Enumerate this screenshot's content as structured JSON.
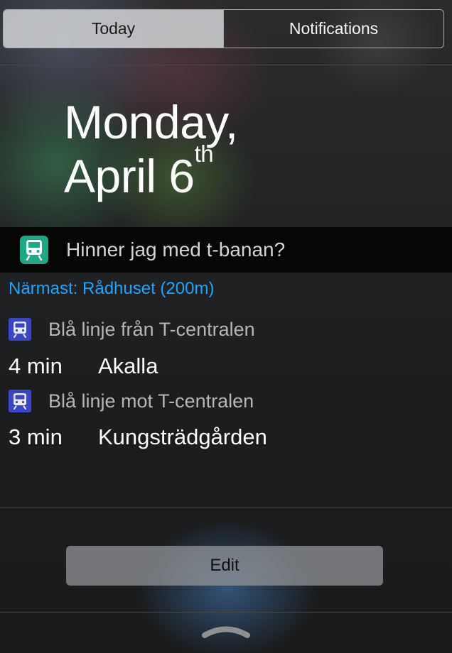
{
  "tabs": {
    "today": "Today",
    "notifications": "Notifications",
    "selected": "Today"
  },
  "date": {
    "weekday_line": "Monday,",
    "month_day": "April 6",
    "ordinal_suffix": "th"
  },
  "widget": {
    "icon": "train-icon",
    "title": "Hinner jag med t-banan?",
    "nearest_station": "Närmast: Rådhuset (200m)",
    "accent_color": "#1ea3ff",
    "line_color": "#3c45c9",
    "routes": [
      {
        "line_label": "Blå linje från T-centralen",
        "time": "4 min",
        "destination": "Akalla"
      },
      {
        "line_label": "Blå linje mot T-centralen",
        "time": "3 min",
        "destination": "Kungsträdgården"
      }
    ]
  },
  "footer": {
    "edit_label": "Edit",
    "grabber_icon": "chevron-up-handle-icon"
  }
}
